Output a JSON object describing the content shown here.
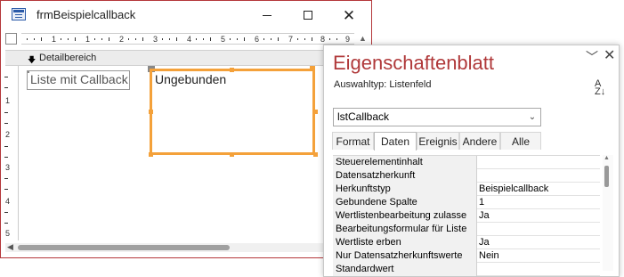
{
  "form_window": {
    "title": "frmBeispielcallback",
    "ruler_marks": "1 · · · 1 · · · 2 · · · 3 · · · 4 · · · 5 · · · 6 · · · 7 · · · 8 · · · 9",
    "section_label": "Detailbereich",
    "vruler_numbers": [
      "1",
      "2",
      "3",
      "4",
      "5"
    ],
    "label_text": "Liste mit Callback:",
    "listbox_text": "Ungebunden"
  },
  "property_sheet": {
    "title": "Eigenschaftenblatt",
    "selection_type": "Auswahltyp:  Listenfeld",
    "sort_az": "A\nZ",
    "object_combo": "lstCallback",
    "tabs": [
      {
        "label": "Format"
      },
      {
        "label": "Daten"
      },
      {
        "label": "Ereignis"
      },
      {
        "label": "Andere"
      },
      {
        "label": "Alle"
      }
    ],
    "rows": [
      {
        "key": "Steuerelementinhalt",
        "value": ""
      },
      {
        "key": "Datensatzherkunft",
        "value": ""
      },
      {
        "key": "Herkunftstyp",
        "value": "Beispielcallback"
      },
      {
        "key": "Gebundene Spalte",
        "value": "1"
      },
      {
        "key": "Wertlistenbearbeitung zulasse",
        "value": "Ja"
      },
      {
        "key": "Bearbeitungsformular für Liste",
        "value": ""
      },
      {
        "key": "Wertliste erben",
        "value": "Ja"
      },
      {
        "key": "Nur Datensatzherkunftswerte",
        "value": "Nein"
      },
      {
        "key": "Standardwert",
        "value": ""
      }
    ]
  },
  "colors": {
    "window_border": "#b4373a",
    "property_title": "#b0393a",
    "selection": "#f4a13a"
  }
}
